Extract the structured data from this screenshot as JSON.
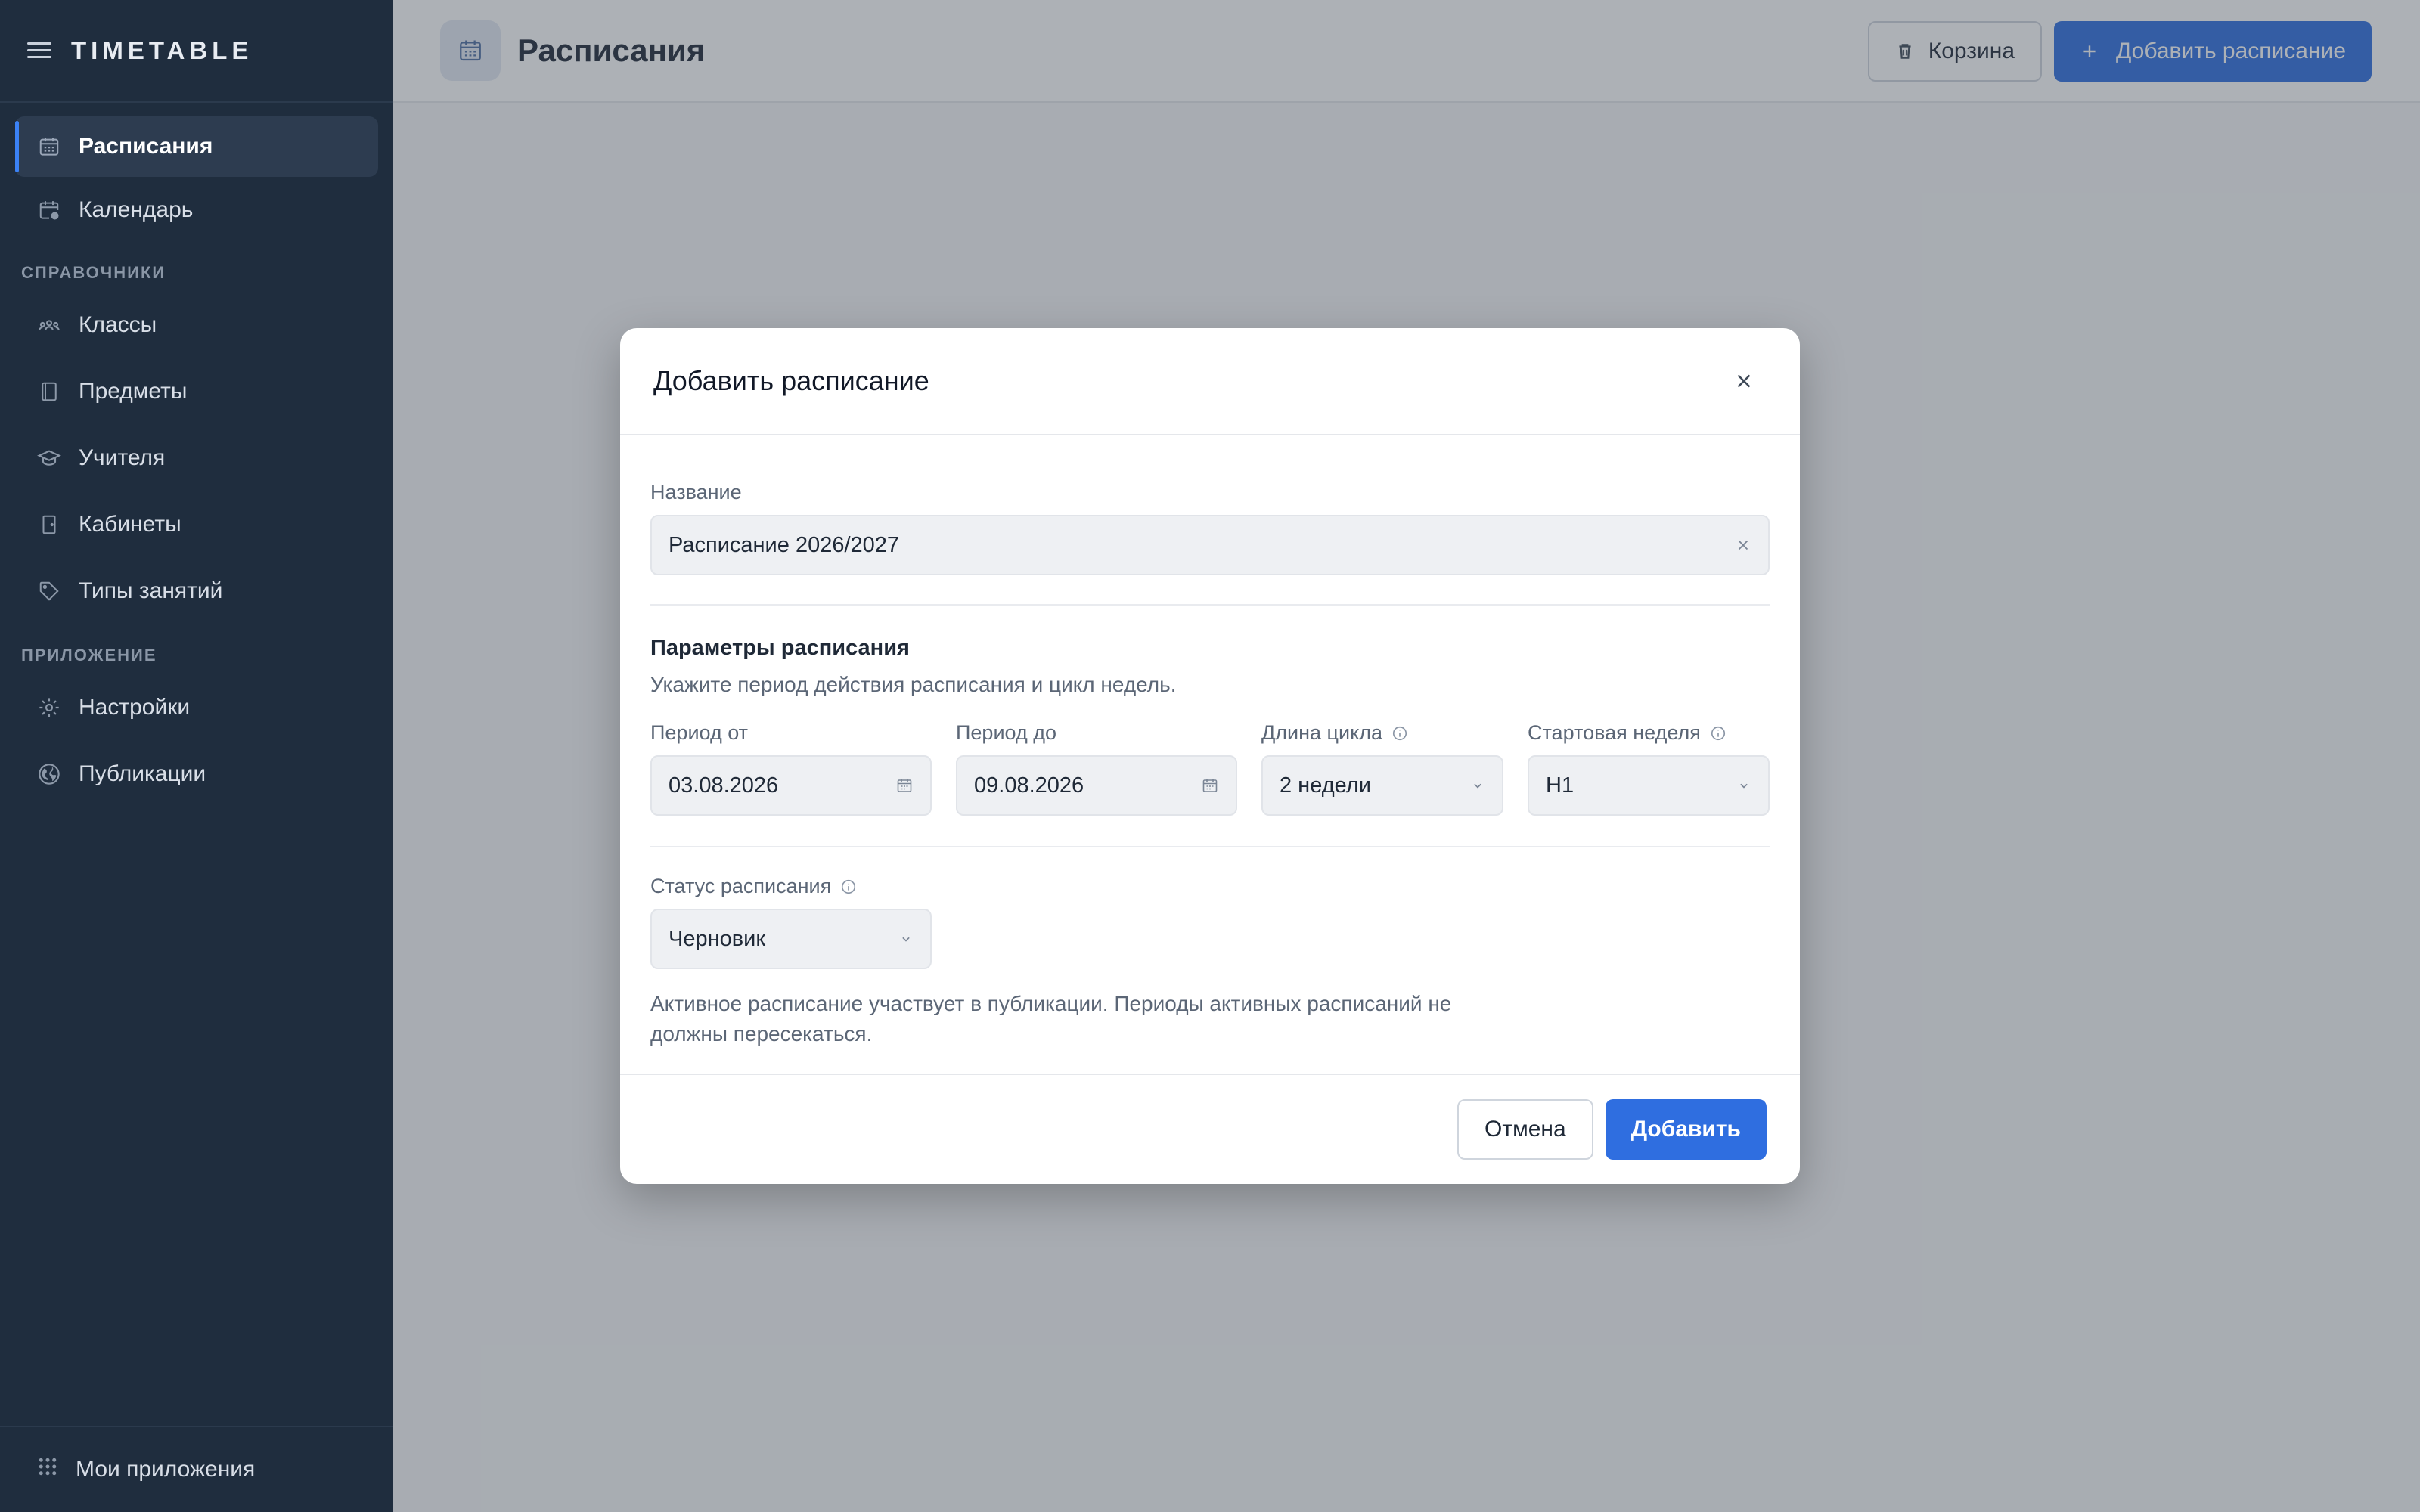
{
  "app": {
    "brand": "TIMETABLE"
  },
  "sidebar": {
    "items_top": [
      {
        "label": "Расписания",
        "icon": "calendar-grid-icon",
        "active": true
      },
      {
        "label": "Календарь",
        "icon": "calendar-clock-icon",
        "active": false
      }
    ],
    "section_refs": "СПРАВОЧНИКИ",
    "items_refs": [
      {
        "label": "Классы",
        "icon": "users-group-icon"
      },
      {
        "label": "Предметы",
        "icon": "book-icon"
      },
      {
        "label": "Учителя",
        "icon": "graduation-cap-icon"
      },
      {
        "label": "Кабинеты",
        "icon": "door-icon"
      },
      {
        "label": "Типы занятий",
        "icon": "tag-icon"
      }
    ],
    "section_app": "ПРИЛОЖЕНИЕ",
    "items_app": [
      {
        "label": "Настройки",
        "icon": "gear-icon"
      },
      {
        "label": "Публикации",
        "icon": "globe-icon"
      }
    ],
    "footer": "Мои приложения"
  },
  "header": {
    "title": "Расписания",
    "trash_label": "Корзина",
    "add_label": "Добавить расписание"
  },
  "modal": {
    "title": "Добавить расписание",
    "name_label": "Название",
    "name_value": "Расписание 2026/2027",
    "params_title": "Параметры расписания",
    "params_desc": "Укажите период действия расписания и цикл недель.",
    "period_from_label": "Период от",
    "period_from_value": "03.08.2026",
    "period_to_label": "Период до",
    "period_to_value": "09.08.2026",
    "cycle_label": "Длина цикла",
    "cycle_value": "2 недели",
    "start_week_label": "Стартовая неделя",
    "start_week_value": "Н1",
    "status_label": "Статус расписания",
    "status_value": "Черновик",
    "status_help": "Активное расписание участвует в публикации. Периоды активных расписаний не должны пересекаться.",
    "cancel_label": "Отмена",
    "submit_label": "Добавить"
  },
  "colors": {
    "sidebar_bg": "#1f2d3e",
    "accent": "#2f6ee0",
    "overlay": "rgba(60,70,80,0.42)"
  }
}
